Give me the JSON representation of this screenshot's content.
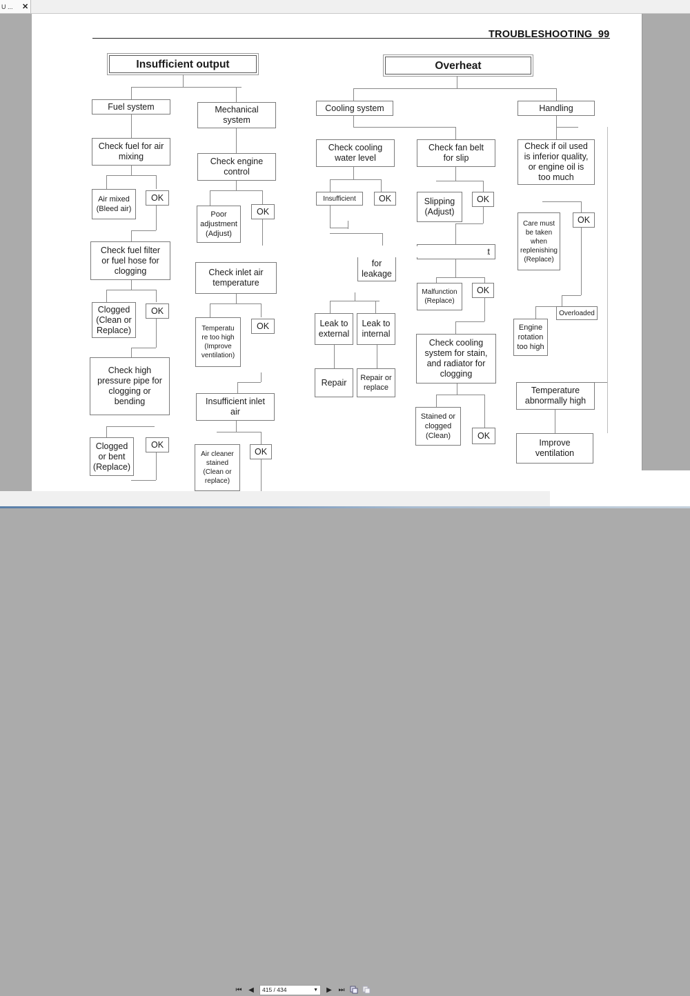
{
  "window": {
    "tab_label": "U ...",
    "tab_close_icon": "close-icon"
  },
  "page": {
    "header_title": "TROUBLESHOOTING",
    "page_number": "99"
  },
  "flow_left": {
    "title": "Insufficient output",
    "fuel_system": {
      "label": "Fuel system",
      "steps": [
        "Check fuel for air\nmixing",
        "Air mixed\n(Bleed air)",
        "OK",
        "Check fuel filter\nor fuel hose for\nclogging",
        "Clogged\n(Clean or\nReplace)",
        "OK",
        "Check high\npressure pipe for\nclogging or\nbending",
        "Clogged\nor bent\n(Replace)",
        "OK"
      ]
    },
    "mechanical_system": {
      "label": "Mechanical\nsystem",
      "steps": [
        "Check engine\ncontrol",
        "Poor\nadjustment\n(Adjust)",
        "OK",
        "Check inlet air\ntemperature",
        "Temperatu\nre too high\n(Improve\nventilation)",
        "OK",
        "Insufficient inlet\nair",
        "Air cleaner\nstained\n(Clean or\nreplace)",
        "OK"
      ]
    }
  },
  "flow_right": {
    "title": "Overheat",
    "cooling_system": {
      "label": "Cooling system",
      "steps": [
        "Check cooling\nwater level",
        "Insufficient",
        "OK",
        "for\nleakage",
        "Leak to\nexternal",
        "Leak to\ninternal",
        "Repair",
        "Repair or\nreplace",
        "Check fan belt\nfor slip",
        "Slipping\n(Adjust)",
        "OK",
        "Check thermostat",
        "Malfunction\n(Replace)",
        "OK",
        "Check cooling\nsystem for stain,\nand radiator for\nclogging",
        "Stained or\nclogged\n(Clean)",
        "OK"
      ]
    },
    "handling": {
      "label": "Handling",
      "steps": [
        "Check if oil used\nis inferior quality,\nor engine oil is\ntoo much",
        "Care must\nbe taken\nwhen\nreplenishing\n(Replace)",
        "OK",
        "Engine\nrotation\ntoo high",
        "Overloaded",
        "Temperature\nabnormally high",
        "Improve\nventilation"
      ]
    }
  },
  "navigation": {
    "page_indicator": "415 / 434",
    "first_icon": "first-page-icon",
    "prev_icon": "previous-page-icon",
    "next_icon": "next-page-icon",
    "last_icon": "last-page-icon"
  }
}
